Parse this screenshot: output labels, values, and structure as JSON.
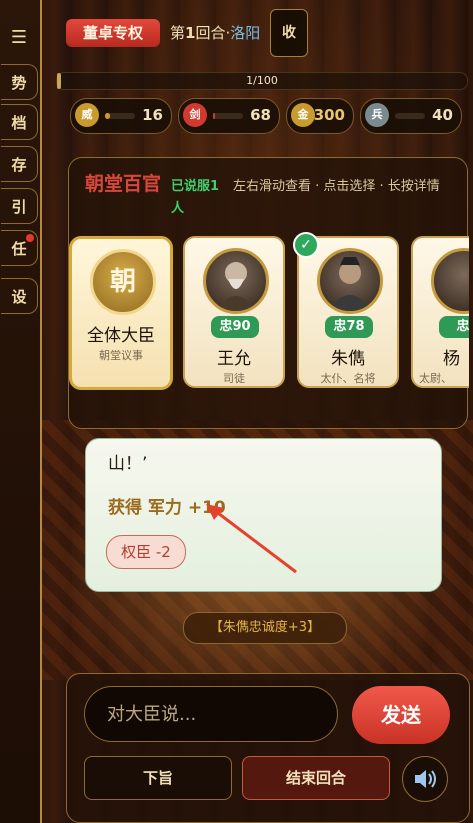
{
  "sidebar": {
    "menu_icon": "menu-icon",
    "items": [
      {
        "label": "势"
      },
      {
        "label": "档"
      },
      {
        "label": "存"
      },
      {
        "label": "引"
      },
      {
        "label": "任",
        "badge": true
      },
      {
        "label": "设"
      }
    ]
  },
  "header": {
    "role_badge": "董卓专权",
    "round_prefix": "第",
    "round_number": "1",
    "round_suffix": "回合·",
    "location": "洛阳",
    "collapse_label": "收"
  },
  "progress": {
    "label": "1/100",
    "current": 1,
    "total": 100
  },
  "stats": [
    {
      "icon": "威",
      "value": "16",
      "level": 0.16,
      "color": "#c99a2e"
    },
    {
      "icon": "剑",
      "value": "68",
      "level": 0.06,
      "color": "#d23a2d"
    },
    {
      "icon": "金",
      "value": "300",
      "level": 1.0,
      "color": "#c99a2e"
    },
    {
      "icon": "兵",
      "value": "40",
      "level": 0.0,
      "color": "#7a8a8f"
    }
  ],
  "court": {
    "title": "朝堂百官",
    "persuaded": "已说服1人",
    "hint": "左右滑动查看 · 点击选择 · 长按详情",
    "cards": [
      {
        "emblem": "朝",
        "name": "全体大臣",
        "role": "朝堂议事"
      },
      {
        "loyalty": "忠90",
        "name": "王允",
        "role": "司徒"
      },
      {
        "loyalty": "忠78",
        "name": "朱儁",
        "role": "太仆、名将",
        "checked": true
      },
      {
        "loyalty": "忠",
        "name": "杨",
        "role": "太尉、"
      }
    ]
  },
  "dialogue": {
    "quote_end": "山！’",
    "reward": "获得 军力 +10",
    "effect": "权臣 -2"
  },
  "toast": "【朱儁忠诚度+3】",
  "input": {
    "placeholder": "对大臣说..."
  },
  "actions": {
    "send": "发送",
    "decree": "下旨",
    "end_round": "结束回合",
    "sound_icon": "speaker-icon"
  },
  "colors": {
    "accent_red": "#d8473b",
    "loyalty_green": "#2f9a55",
    "gold": "#c49a3e"
  }
}
